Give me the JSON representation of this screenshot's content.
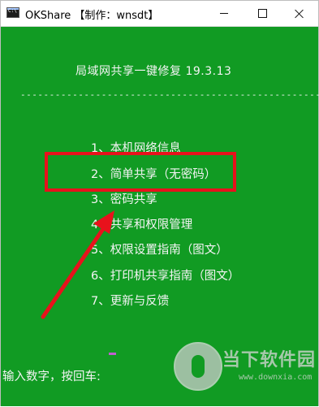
{
  "window": {
    "title": "OKShare 【制作：wnsdt】",
    "icon": "console-app-icon",
    "icon_text": "C:\\"
  },
  "console": {
    "heading": "局域网共享一键修复 19.3.13",
    "divider": "------------------------------------------------------",
    "menu": [
      {
        "label": "1、本机网络信息"
      },
      {
        "label": "2、简单共享（无密码）"
      },
      {
        "label": "3、密码共享"
      },
      {
        "label": "4、共享和权限管理"
      },
      {
        "label": "5、权限设置指南（图文）"
      },
      {
        "label": "6、打印机共享指南（图文）"
      },
      {
        "label": "7、更新与反馈"
      }
    ],
    "prompt": "输入数字，按回车:"
  },
  "annotation": {
    "highlight_color": "#e8121c",
    "highlighted_item": "3、密码共享"
  },
  "watermark": {
    "title": "当下软件园",
    "url": "www.downxia.com"
  },
  "colors": {
    "console_bg": "#119b23",
    "text": "#f4f4f4",
    "cursor": "#c060d0"
  }
}
